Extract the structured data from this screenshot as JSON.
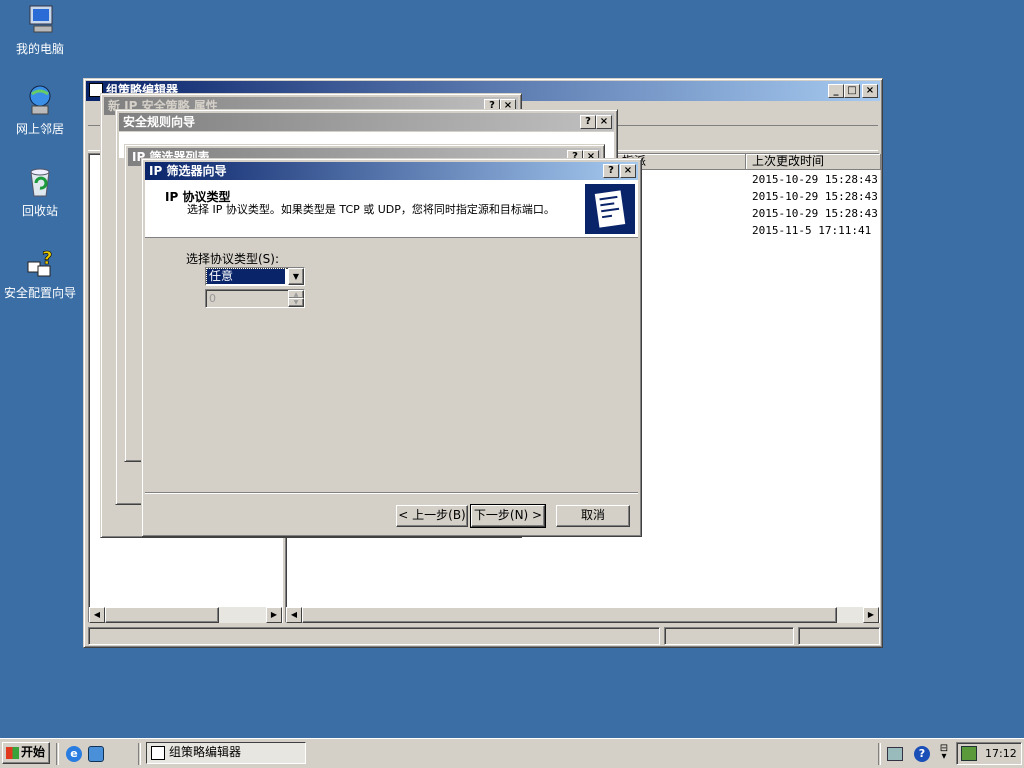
{
  "desktop": {
    "icons": [
      {
        "label": "我的电脑",
        "icon": "computer-icon"
      },
      {
        "label": "网上邻居",
        "icon": "network-icon"
      },
      {
        "label": "回收站",
        "icon": "recycle-bin-icon"
      },
      {
        "label": "安全配置向导",
        "icon": "security-wizard-icon"
      }
    ]
  },
  "gpedit": {
    "title": "组策略编辑器",
    "list_headers": [
      "指派",
      "上次更改时间"
    ],
    "rows": [
      "2015-10-29 15:28:43",
      "2015-10-29 15:28:43",
      "2015-10-29 15:28:43",
      "2015-11-5 17:11:41"
    ]
  },
  "policy_props": {
    "title": "新 IP 安全策略 属性"
  },
  "rule_wizard": {
    "title": "安全规则向导",
    "partial_text": "IP 筛..."
  },
  "filter_list": {
    "title": "IP 筛选器列表"
  },
  "filter_wizard": {
    "title": "IP 筛选器向导",
    "heading": "IP 协议类型",
    "description": "选择 IP 协议类型。如果类型是 TCP 或 UDP，您将同时指定源和目标端口。",
    "protocol_label": "选择协议类型(S):",
    "protocol_value": "任意",
    "port_value": "0",
    "back_label": "< 上一步(B)",
    "next_label": "下一步(N) >",
    "cancel_label": "取消"
  },
  "title_buttons": {
    "help": "?",
    "close": "×",
    "minimize": "_",
    "maximize": "□"
  },
  "taskbar": {
    "start_label": "开始",
    "task_label": "组策略编辑器",
    "clock": "17:12"
  },
  "colors": {
    "desktop": "#3a6ea5",
    "titlebar": "#0a246a",
    "face": "#d4d0c8"
  }
}
